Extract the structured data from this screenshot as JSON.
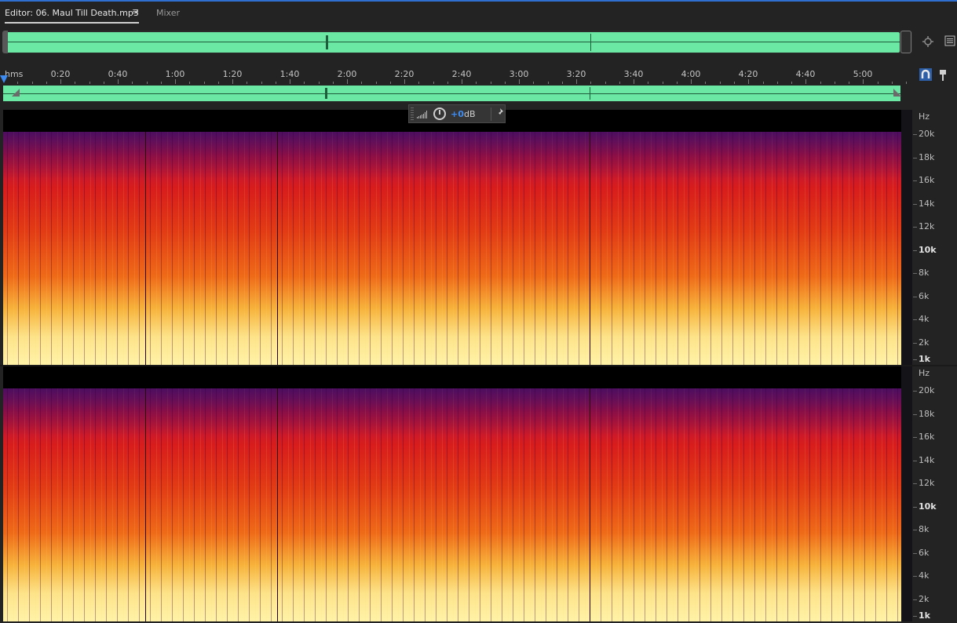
{
  "tabs": {
    "editor_label": "Editor: 06. Maul Till Death.mp3",
    "menu_glyph": "≡",
    "mixer_label": "Mixer"
  },
  "ruler": {
    "unit": "hms",
    "labels": [
      "0:20",
      "0:40",
      "1:00",
      "1:20",
      "1:40",
      "2:00",
      "2:20",
      "2:40",
      "3:00",
      "3:20",
      "3:40",
      "4:00",
      "4:20",
      "4:40",
      "5:00"
    ]
  },
  "hud": {
    "gain_value": "+0",
    "gain_unit": "dB",
    "pin_glyph": "📌"
  },
  "channels": [
    {
      "unit": "Hz",
      "freq_labels": [
        "20k",
        "18k",
        "16k",
        "14k",
        "12k",
        "10k",
        "8k",
        "6k",
        "4k",
        "2k",
        "1k"
      ]
    },
    {
      "unit": "Hz",
      "freq_labels": [
        "20k",
        "18k",
        "16k",
        "14k",
        "12k",
        "10k",
        "8k",
        "6k",
        "4k",
        "2k",
        "1k"
      ]
    }
  ],
  "icons": {
    "zoom": "zoom-navigator-icon",
    "panel_menu": "panel-menu-icon",
    "snap": "magnet-snap-icon",
    "marker": "marker-pin-icon"
  },
  "colors": {
    "waveform": "#6ce8a5",
    "playhead": "#3d8bf0",
    "accent_line": "#2f6fd0"
  }
}
